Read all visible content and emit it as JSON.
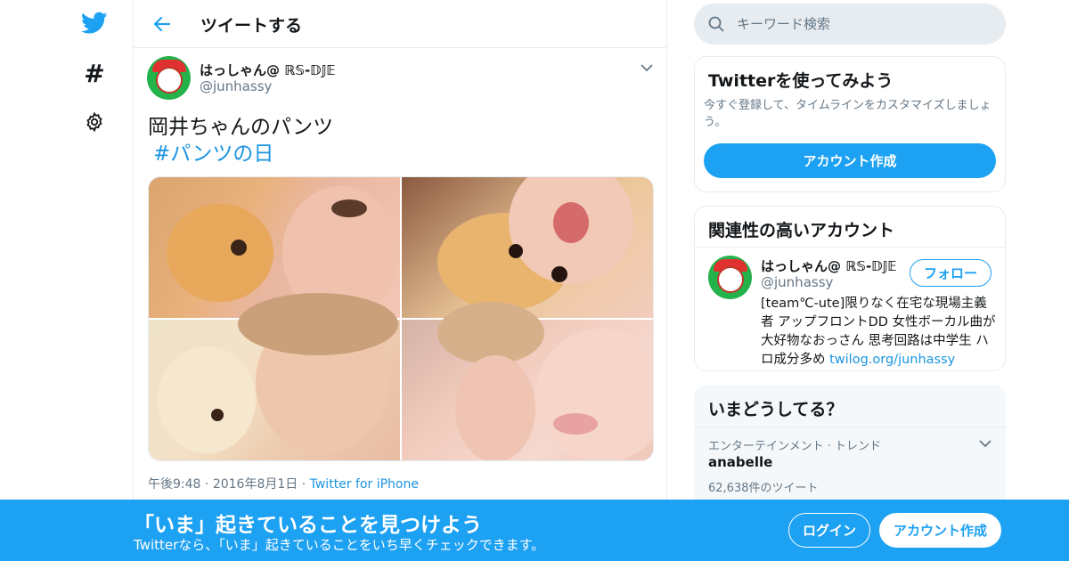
{
  "colors": {
    "brand": "#1da1f2",
    "link": "#1b95e0",
    "muted": "#657786",
    "border": "#e6ecf0"
  },
  "nav": {
    "icons": [
      "twitter-bird-icon",
      "hashtag-icon",
      "gear-icon"
    ],
    "hashtag_glyph": "#"
  },
  "header": {
    "title": "ツイートする"
  },
  "tweet": {
    "author_name": "はっしゃん@ ℝ𝕊-𝔻𝕁𝔼",
    "author_handle": "@junhassy",
    "text": "岡井ちゃんのパンツ",
    "hashtag": "#パンツの日",
    "time": "午後9:48",
    "date": "2016年8月1日",
    "separator": "·",
    "source": "Twitter for iPhone",
    "photo_count": 4
  },
  "search": {
    "placeholder": "キーワード検索"
  },
  "signup_card": {
    "title": "Twitterを使ってみよう",
    "description": "今すぐ登録して、タイムラインをカスタマイズしましょう。",
    "button": "アカウント作成"
  },
  "related_card": {
    "title": "関連性の高いアカウント",
    "name": "はっしゃん@ ℝ𝕊-𝔻𝕁𝔼",
    "handle": "@junhassy",
    "follow_button": "フォロー",
    "bio": "[team℃-ute]限りなく在宅な現場主義者 アップフロントDD 女性ボーカル曲が大好物なおっさん 思考回路は中学生 ハロ成分多め ",
    "bio_link": "twilog.org/junhassy"
  },
  "trends_card": {
    "title": "いまどうしてる？",
    "category": "エンターテインメント · トレンド",
    "trend_name": "anabelle",
    "tweet_count": "62,638件のツイート"
  },
  "banner": {
    "title": "「いま」起きていることを見つけよう",
    "subtitle": "Twitterなら、「いま」起きていることをいち早くチェックできます。",
    "login_button": "ログイン",
    "signup_button": "アカウント作成"
  }
}
